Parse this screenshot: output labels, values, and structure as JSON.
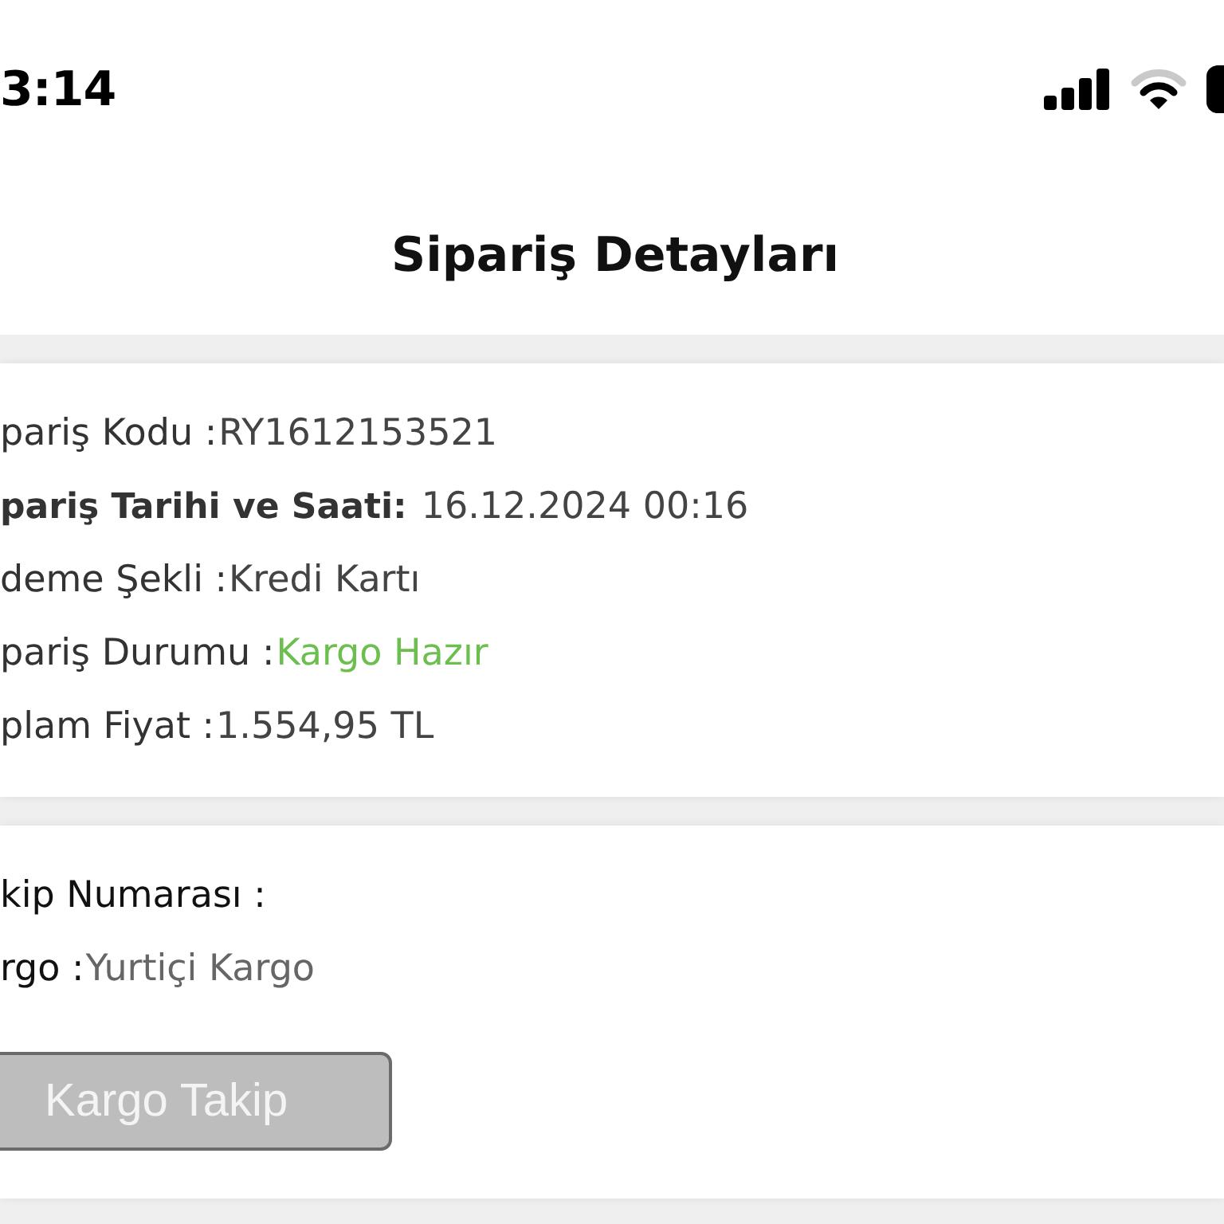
{
  "status_bar": {
    "time": "3:14"
  },
  "header": {
    "title": "Sipariş Detayları"
  },
  "order_card": {
    "rows": [
      {
        "kind": "plain",
        "label": "pariş Kodu :",
        "value": "RY1612153521"
      },
      {
        "kind": "emphasis",
        "label": "pariş Tarihi ve Saati:",
        "value": "16.12.2024 00:16"
      },
      {
        "kind": "plain",
        "label": "deme Şekli :",
        "value": "Kredi Kartı"
      },
      {
        "kind": "status",
        "label": "pariş Durumu :",
        "value": "Kargo Hazır"
      },
      {
        "kind": "plain",
        "label": "plam Fiyat :",
        "value": "1.554,95 TL"
      }
    ]
  },
  "shipping_card": {
    "rows": [
      {
        "kind": "plain",
        "label": "kip Numarası :"
      },
      {
        "kind": "plain",
        "label": "rgo :",
        "value": "Yurtiçi Kargo"
      }
    ],
    "button": {
      "label": "Kargo Takip",
      "disabled": true
    }
  }
}
